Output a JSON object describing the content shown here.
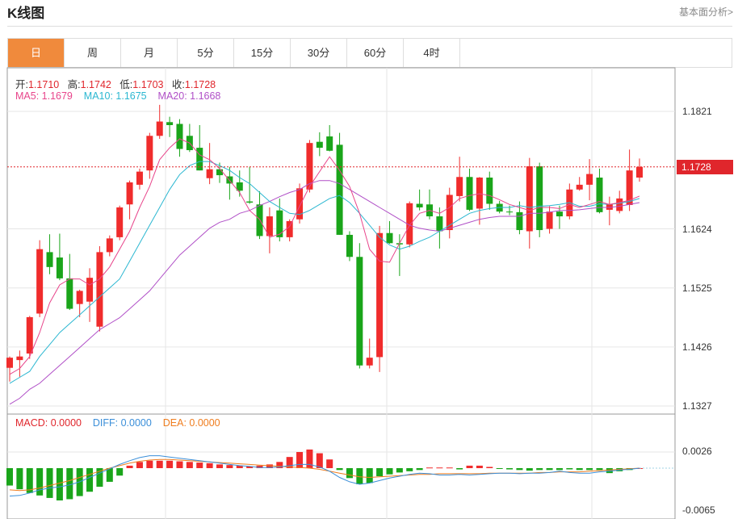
{
  "title": "K线图",
  "fundamental_link": "基本面分析>",
  "tabs": [
    "日",
    "周",
    "月",
    "5分",
    "15分",
    "30分",
    "60分",
    "4时"
  ],
  "active_tab": 0,
  "ohlc": {
    "open_label": "开:",
    "open": "1.1710",
    "high_label": "高:",
    "high": "1.1742",
    "low_label": "低:",
    "low": "1.1703",
    "close_label": "收:",
    "close": "1.1728"
  },
  "ma_legend": [
    {
      "label": "MA5: 1.1679",
      "color": "#e8458b"
    },
    {
      "label": "MA10: 1.1675",
      "color": "#2bb7d1"
    },
    {
      "label": "MA20: 1.1668",
      "color": "#b04fc7"
    }
  ],
  "macd_legend": [
    {
      "label": "MACD: 0.0000",
      "color": "#e0262c"
    },
    {
      "label": "DIFF: 0.0000",
      "color": "#3b8fd9"
    },
    {
      "label": "DEA: 0.0000",
      "color": "#ef7d1f"
    }
  ],
  "colors": {
    "up": "#f02c2c",
    "down": "#1aa51a",
    "grid": "#e6e6e6"
  },
  "chart_data": {
    "type": "candlestick",
    "y_ticks": [
      "1.1821",
      "1.1624",
      "1.1525",
      "1.1426",
      "1.1327"
    ],
    "y_range": [
      1.1305,
      1.1885
    ],
    "last_price": "1.1728",
    "macd_ticks": [
      "0.0026",
      "-0.0065"
    ],
    "macd_range": [
      -0.007,
      0.004
    ],
    "candles": [
      [
        1.1391,
        1.141,
        1.1368,
        1.1408
      ],
      [
        1.1404,
        1.142,
        1.1376,
        1.141
      ],
      [
        1.1415,
        1.1478,
        1.1406,
        1.1476
      ],
      [
        1.1482,
        1.1605,
        1.1476,
        1.159
      ],
      [
        1.1585,
        1.1615,
        1.1548,
        1.156
      ],
      [
        1.1576,
        1.1616,
        1.1538,
        1.1541
      ],
      [
        1.1541,
        1.1582,
        1.1488,
        1.149
      ],
      [
        1.1498,
        1.1522,
        1.1476,
        1.152
      ],
      [
        1.1502,
        1.1558,
        1.1468,
        1.1542
      ],
      [
        1.146,
        1.1595,
        1.1452,
        1.1585
      ],
      [
        1.1585,
        1.1613,
        1.1578,
        1.1608
      ],
      [
        1.161,
        1.1663,
        1.1605,
        1.166
      ],
      [
        1.1665,
        1.1705,
        1.164,
        1.1702
      ],
      [
        1.1698,
        1.1725,
        1.169,
        1.172
      ],
      [
        1.1722,
        1.1785,
        1.1708,
        1.178
      ],
      [
        1.178,
        1.1832,
        1.1775,
        1.1804
      ],
      [
        1.1803,
        1.1812,
        1.1778,
        1.1798
      ],
      [
        1.18,
        1.1808,
        1.1745,
        1.1758
      ],
      [
        1.178,
        1.18,
        1.1753,
        1.1756
      ],
      [
        1.176,
        1.1798,
        1.1722,
        1.1722
      ],
      [
        1.1709,
        1.1768,
        1.1699,
        1.1724
      ],
      [
        1.1724,
        1.1735,
        1.1701,
        1.1714
      ],
      [
        1.1712,
        1.1728,
        1.1673,
        1.17
      ],
      [
        1.1702,
        1.1722,
        1.1678,
        1.1688
      ],
      [
        1.167,
        1.1728,
        1.1666,
        1.1668
      ],
      [
        1.1665,
        1.1687,
        1.1607,
        1.1612
      ],
      [
        1.1612,
        1.166,
        1.1583,
        1.1645
      ],
      [
        1.1655,
        1.1675,
        1.1603,
        1.161
      ],
      [
        1.161,
        1.164,
        1.1603,
        1.1637
      ],
      [
        1.164,
        1.17,
        1.1633,
        1.1692
      ],
      [
        1.169,
        1.1773,
        1.1685,
        1.1768
      ],
      [
        1.177,
        1.1786,
        1.1746,
        1.176
      ],
      [
        1.1779,
        1.1798,
        1.1754,
        1.1755
      ],
      [
        1.1765,
        1.1785,
        1.1614,
        1.1614
      ],
      [
        1.1614,
        1.162,
        1.157,
        1.1577
      ],
      [
        1.1577,
        1.16,
        1.139,
        1.1395
      ],
      [
        1.1395,
        1.144,
        1.139,
        1.1408
      ],
      [
        1.1409,
        1.1629,
        1.1384,
        1.1617
      ],
      [
        1.1617,
        1.1637,
        1.1599,
        1.16
      ],
      [
        1.16,
        1.1615,
        1.1545,
        1.1598
      ],
      [
        1.1598,
        1.167,
        1.1593,
        1.1667
      ],
      [
        1.1666,
        1.169,
        1.1655,
        1.166
      ],
      [
        1.1665,
        1.169,
        1.164,
        1.1645
      ],
      [
        1.1645,
        1.166,
        1.1591,
        1.162
      ],
      [
        1.1622,
        1.1693,
        1.1608,
        1.1681
      ],
      [
        1.1679,
        1.1745,
        1.167,
        1.1711
      ],
      [
        1.1711,
        1.1725,
        1.1654,
        1.1656
      ],
      [
        1.1658,
        1.1711,
        1.1631,
        1.171
      ],
      [
        1.171,
        1.172,
        1.1656,
        1.1666
      ],
      [
        1.1666,
        1.1671,
        1.165,
        1.1653
      ],
      [
        1.1653,
        1.1663,
        1.1647,
        1.1652
      ],
      [
        1.1652,
        1.167,
        1.1615,
        1.1622
      ],
      [
        1.162,
        1.1743,
        1.1591,
        1.1729
      ],
      [
        1.1729,
        1.1735,
        1.161,
        1.1622
      ],
      [
        1.1624,
        1.1662,
        1.1616,
        1.1653
      ],
      [
        1.1653,
        1.1663,
        1.1624,
        1.1645
      ],
      [
        1.1645,
        1.17,
        1.164,
        1.169
      ],
      [
        1.169,
        1.1711,
        1.1688,
        1.1698
      ],
      [
        1.1698,
        1.1741,
        1.1672,
        1.1716
      ],
      [
        1.171,
        1.1725,
        1.165,
        1.1652
      ],
      [
        1.1656,
        1.1678,
        1.163,
        1.1665
      ],
      [
        1.1654,
        1.1688,
        1.165,
        1.1675
      ],
      [
        1.1664,
        1.1757,
        1.1654,
        1.1722
      ],
      [
        1.171,
        1.1742,
        1.1703,
        1.1728
      ]
    ],
    "ma5": [
      1.138,
      1.139,
      1.141,
      1.145,
      1.15,
      1.153,
      1.154,
      1.154,
      1.153,
      1.154,
      1.156,
      1.159,
      1.162,
      1.166,
      1.1695,
      1.174,
      1.176,
      1.1775,
      1.1768,
      1.1748,
      1.174,
      1.1725,
      1.1705,
      1.1685,
      1.1655,
      1.164,
      1.161,
      1.1615,
      1.1628,
      1.1662,
      1.1695,
      1.172,
      1.1745,
      1.1722,
      1.1695,
      1.165,
      1.159,
      1.157,
      1.1568,
      1.16,
      1.163,
      1.165,
      1.1655,
      1.165,
      1.166,
      1.1675,
      1.168,
      1.1683,
      1.168,
      1.1673,
      1.1665,
      1.166,
      1.1655,
      1.166,
      1.166,
      1.1658,
      1.1665,
      1.166,
      1.1665,
      1.167,
      1.1665,
      1.1668,
      1.1672,
      1.1679
    ],
    "ma10": [
      1.1365,
      1.1375,
      1.1385,
      1.141,
      1.143,
      1.145,
      1.1465,
      1.148,
      1.1495,
      1.151,
      1.1525,
      1.154,
      1.157,
      1.16,
      1.163,
      1.166,
      1.169,
      1.1715,
      1.173,
      1.1737,
      1.1737,
      1.173,
      1.1722,
      1.171,
      1.17,
      1.1685,
      1.167,
      1.166,
      1.165,
      1.1648,
      1.1655,
      1.1665,
      1.1675,
      1.168,
      1.1668,
      1.165,
      1.163,
      1.161,
      1.1597,
      1.159,
      1.1595,
      1.1603,
      1.161,
      1.162,
      1.163,
      1.164,
      1.165,
      1.1655,
      1.1658,
      1.166,
      1.166,
      1.1663,
      1.166,
      1.1662,
      1.1663,
      1.1665,
      1.1668,
      1.1662,
      1.1662,
      1.1666,
      1.1665,
      1.1667,
      1.167,
      1.1675
    ],
    "ma20": [
      1.133,
      1.134,
      1.1355,
      1.1365,
      1.138,
      1.1395,
      1.141,
      1.1425,
      1.144,
      1.1455,
      1.1465,
      1.1475,
      1.149,
      1.1505,
      1.152,
      1.154,
      1.156,
      1.158,
      1.1595,
      1.161,
      1.1625,
      1.1635,
      1.164,
      1.165,
      1.1655,
      1.1663,
      1.167,
      1.1678,
      1.1685,
      1.169,
      1.17,
      1.1705,
      1.1705,
      1.17,
      1.169,
      1.168,
      1.167,
      1.166,
      1.165,
      1.164,
      1.163,
      1.1625,
      1.1622,
      1.162,
      1.1625,
      1.163,
      1.1635,
      1.164,
      1.1643,
      1.1645,
      1.1645,
      1.1645,
      1.165,
      1.165,
      1.1652,
      1.1655,
      1.1655,
      1.1656,
      1.1658,
      1.166,
      1.166,
      1.1662,
      1.1665,
      1.1668
    ],
    "macd": [
      -0.0028,
      -0.0034,
      -0.004,
      -0.0044,
      -0.0048,
      -0.0052,
      -0.005,
      -0.0045,
      -0.0038,
      -0.003,
      -0.0022,
      -0.0012,
      0.0004,
      0.001,
      0.0012,
      0.0012,
      0.0012,
      0.0011,
      0.001,
      0.0009,
      0.0008,
      0.0006,
      0.0005,
      0.0004,
      0.0003,
      0.0004,
      0.0006,
      0.001,
      0.0018,
      0.0026,
      0.003,
      0.0024,
      0.0014,
      -0.0003,
      -0.0016,
      -0.0026,
      -0.0024,
      -0.0013,
      -0.001,
      -0.0007,
      -0.0005,
      -0.0003,
      0.0001,
      0.0001,
      0.0001,
      -0.0002,
      0.0004,
      0.0004,
      0.0002,
      -0.0001,
      -0.0002,
      -0.0003,
      -0.0004,
      -0.0003,
      -0.0003,
      -0.0003,
      -0.0002,
      -0.0003,
      -0.0003,
      -0.0003,
      -0.0008,
      -0.0005,
      -0.0003,
      0.0
    ],
    "diff": [
      -0.0045,
      -0.0044,
      -0.004,
      -0.0035,
      -0.0032,
      -0.003,
      -0.0027,
      -0.0022,
      -0.0015,
      -0.0008,
      -0.0001,
      0.0006,
      0.0012,
      0.0017,
      0.002,
      0.002,
      0.0018,
      0.0016,
      0.0014,
      0.0012,
      0.001,
      0.0008,
      0.0006,
      0.0004,
      0.0003,
      0.0001,
      0.0001,
      0.0002,
      0.0004,
      0.0006,
      0.0006,
      0.0002,
      -0.0005,
      -0.0015,
      -0.0022,
      -0.0026,
      -0.0024,
      -0.002,
      -0.0016,
      -0.0013,
      -0.001,
      -0.0008,
      -0.0009,
      -0.0011,
      -0.0011,
      -0.001,
      -0.0011,
      -0.001,
      -0.0009,
      -0.0008,
      -0.0008,
      -0.0009,
      -0.0008,
      -0.0008,
      -0.0007,
      -0.0005,
      -0.0007,
      -0.0008,
      -0.0008,
      -0.0006,
      -0.0005,
      -0.0003,
      -0.0002,
      0.0
    ],
    "dea": [
      -0.0035,
      -0.0036,
      -0.0035,
      -0.0032,
      -0.0028,
      -0.0024,
      -0.002,
      -0.0015,
      -0.001,
      -0.0005,
      0.0,
      0.0004,
      0.0008,
      0.0011,
      0.0013,
      0.0014,
      0.0014,
      0.0013,
      0.0012,
      0.0011,
      0.001,
      0.0009,
      0.0008,
      0.0007,
      0.0006,
      0.0005,
      0.0004,
      0.0003,
      0.0002,
      0.0001,
      0.0,
      -0.0002,
      -0.0005,
      -0.0008,
      -0.0011,
      -0.0014,
      -0.0015,
      -0.0014,
      -0.0013,
      -0.0012,
      -0.0011,
      -0.001,
      -0.001,
      -0.0009,
      -0.0009,
      -0.0009,
      -0.0009,
      -0.0009,
      -0.0008,
      -0.0008,
      -0.0008,
      -0.0008,
      -0.0008,
      -0.0007,
      -0.0007,
      -0.0006,
      -0.0006,
      -0.0006,
      -0.0005,
      -0.0004,
      -0.0003,
      -0.0002,
      -0.0001,
      0.0
    ]
  }
}
